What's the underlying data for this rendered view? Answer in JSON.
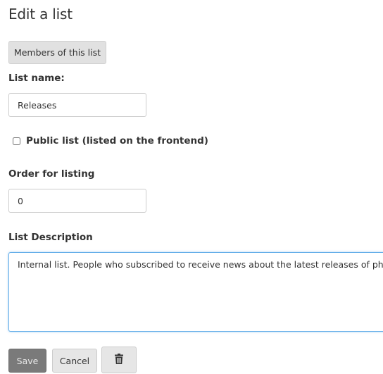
{
  "page": {
    "title": "Edit a list"
  },
  "members_button": {
    "label": "Members of this list"
  },
  "list_name": {
    "label": "List name:",
    "value": "Releases"
  },
  "public_list": {
    "label": "Public list (listed on the frontend)",
    "checked": false
  },
  "order": {
    "label": "Order for listing",
    "value": "0"
  },
  "description": {
    "label": "List Description",
    "value": "Internal list. People who subscribed to receive news about the latest releases of phpList."
  },
  "actions": {
    "save_label": "Save",
    "cancel_label": "Cancel",
    "delete_icon": "trash-icon"
  },
  "colors": {
    "save_bg": "#7a7a7a",
    "focus_border": "#66afe9"
  }
}
